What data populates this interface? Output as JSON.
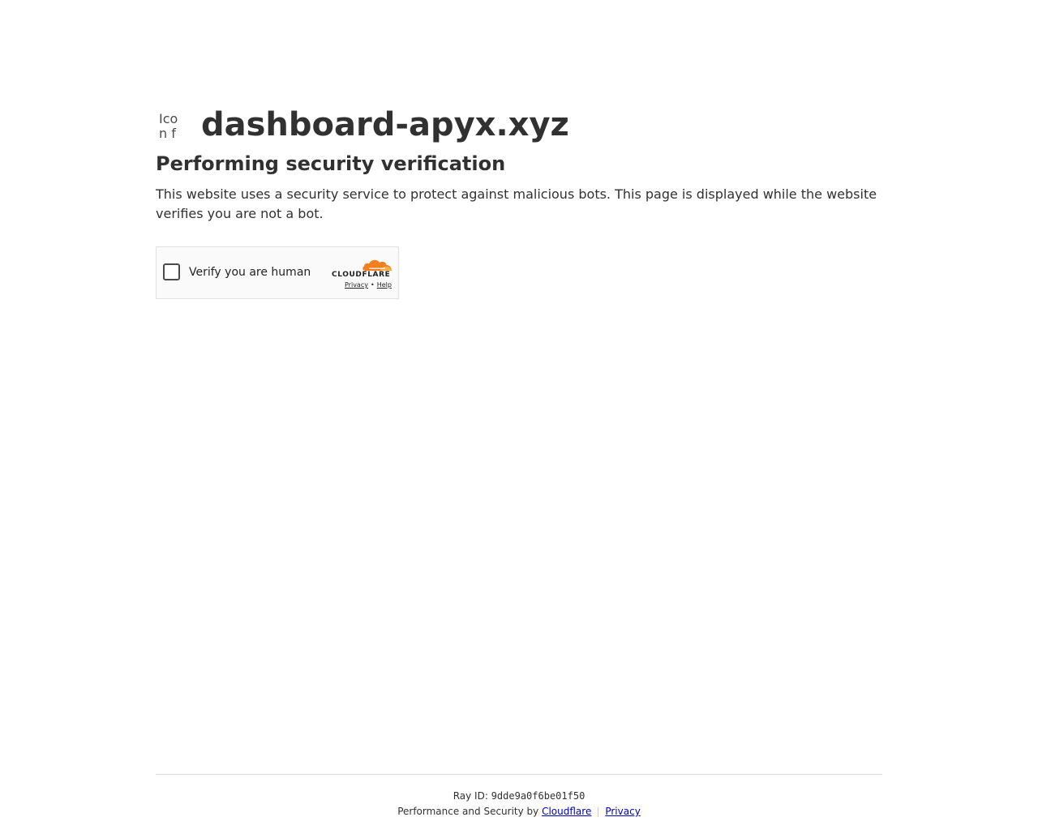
{
  "site": {
    "favicon_alt": "Icon for",
    "domain": "dashboard-apyx.xyz"
  },
  "main": {
    "headline": "Performing security verification",
    "description": "This website uses a security service to protect against malicious bots. This page is displayed while the website verifies you are not a bot."
  },
  "widget": {
    "checkbox_label": "Verify you are human",
    "brand": "CLOUDFLARE",
    "privacy_link": "Privacy",
    "dot": "•",
    "help_link": "Help",
    "brand_color": "#f38020"
  },
  "footer": {
    "ray_label": "Ray ID:",
    "ray_id": "9dde9a0f6be01f50",
    "perf_text": "Performance and Security by",
    "cloudflare_link": "Cloudflare",
    "privacy_link": "Privacy"
  }
}
